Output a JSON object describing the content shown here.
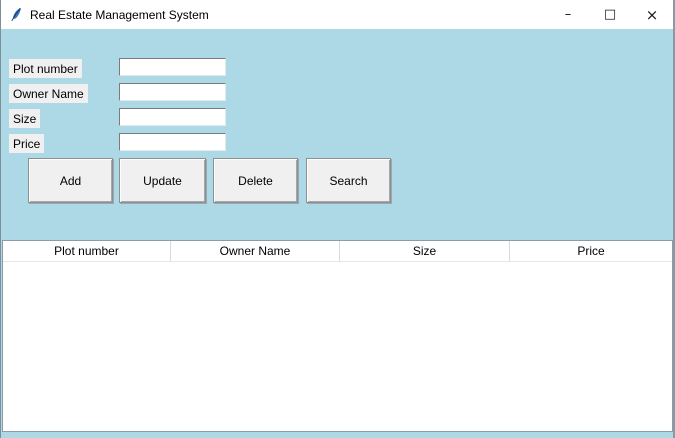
{
  "window": {
    "title": "Real Estate Management System",
    "icon": "tk-feather",
    "controls": [
      {
        "name": "minimize",
        "glyph": "–"
      },
      {
        "name": "maximize",
        "glyph": "□"
      },
      {
        "name": "close",
        "glyph": "×"
      }
    ]
  },
  "form": {
    "fields": [
      {
        "label": "Plot number",
        "value": ""
      },
      {
        "label": "Owner Name",
        "value": ""
      },
      {
        "label": "Size",
        "value": ""
      },
      {
        "label": "Price",
        "value": ""
      }
    ]
  },
  "actions": {
    "add": "Add",
    "update": "Update",
    "delete": "Delete",
    "search": "Search"
  },
  "table": {
    "columns": [
      {
        "label": "Plot number"
      },
      {
        "label": "Owner Name"
      },
      {
        "label": "Size"
      },
      {
        "label": "Price"
      }
    ],
    "rows": []
  },
  "colors": {
    "window_background": "#ADD8E6",
    "titlebar_background": "#FFFFFF",
    "control_surface": "#F0F0F0",
    "table_background": "#FFFFFF",
    "text": "#000000",
    "feather_blue": "#3A76C4"
  }
}
